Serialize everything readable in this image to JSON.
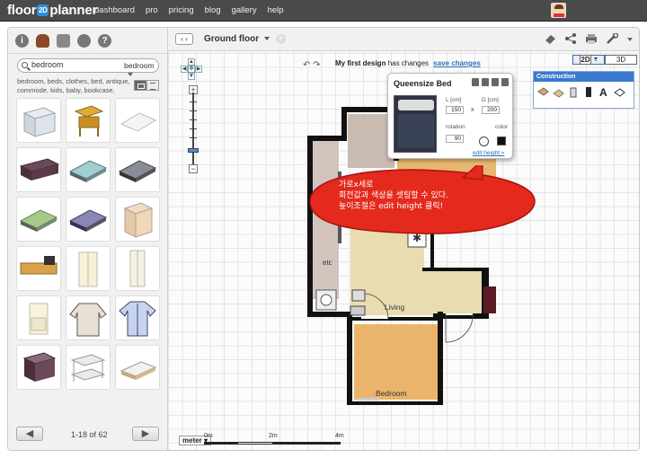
{
  "app": {
    "logo_left": "floor",
    "logo_mid": "2D",
    "logo_right": "planner"
  },
  "nav": [
    "dashboard",
    "pro",
    "pricing",
    "blog",
    "gallery",
    "help"
  ],
  "library": {
    "search_value": "bedroom",
    "category": "bedroom",
    "tags": "bedroom, beds, clothes, bed, antique, commode, kids, baby, bookcase,",
    "pager": "1-18 of 62",
    "prev": "◀",
    "next": "▶"
  },
  "toolbar": {
    "floor": "Ground floor",
    "nav_arrows": "‹ ›",
    "add_floor": "+",
    "design_name": "My first design",
    "status": "has changes",
    "save": "save changes",
    "view_2d": "2D",
    "view_3d": "3D",
    "undo_redo": "↶ ↷"
  },
  "popup": {
    "title": "Queensize Bed",
    "l_label": "L [cm]",
    "l_value": "150",
    "d_label": "D [cm]",
    "d_value": "200",
    "x": "x",
    "rotation_label": "rotation",
    "rotation_value": "90",
    "color_label": "color",
    "color_value": "#111111",
    "edit_height": "edit height »"
  },
  "construction": {
    "title": "Construction"
  },
  "plan": {
    "rooms": {
      "etc": "etc",
      "living": "Living",
      "bedroom": "Bedroom",
      "bedroom_hidden": "Bedroom"
    }
  },
  "bubble": {
    "line1": "가로x세로",
    "line2": "회전값과 색상을 셋팅할 수 있다.",
    "line3": "높이조절은 edit height 클릭!"
  },
  "scale": {
    "unit": "meter",
    "t0": "0m",
    "t2": "2m",
    "t4": "4m"
  },
  "colors": {
    "accent": "#3a7ad0",
    "topbar": "#4a4a4a",
    "bubble": "#e32a1c",
    "room_fill": "#e8dcb0",
    "bedroom_fill": "#e8b870"
  }
}
